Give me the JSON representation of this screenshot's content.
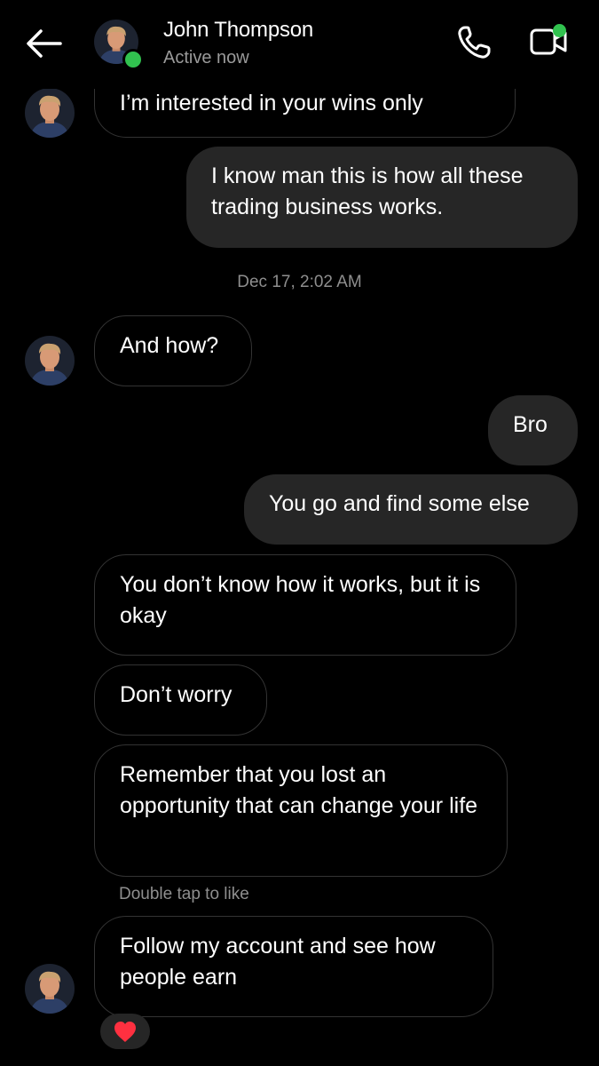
{
  "header": {
    "name": "John Thompson",
    "status": "Active now",
    "icons": [
      "back-arrow-icon",
      "phone-icon",
      "video-call-icon"
    ],
    "active_color": "#31c24f"
  },
  "messages": [
    {
      "from": "them",
      "text": "I’m interested in your wins only"
    },
    {
      "from": "me",
      "text": "I know man this is how all these trading business works."
    },
    {
      "type": "timestamp",
      "text": "Dec 17, 2:02 AM"
    },
    {
      "from": "them",
      "text": "And how?"
    },
    {
      "from": "me",
      "text": "Bro"
    },
    {
      "from": "me",
      "text": "You go and find some else"
    },
    {
      "from": "them",
      "text": "You don’t know how it works, but it is okay"
    },
    {
      "from": "them",
      "text": "Don’t worry"
    },
    {
      "from": "them",
      "text": "Remember that you lost an opportunity that can change your life"
    },
    {
      "type": "hint",
      "text": "Double tap to like"
    },
    {
      "from": "them",
      "text": "Follow my account and see how people earn",
      "reaction": "heart"
    }
  ]
}
